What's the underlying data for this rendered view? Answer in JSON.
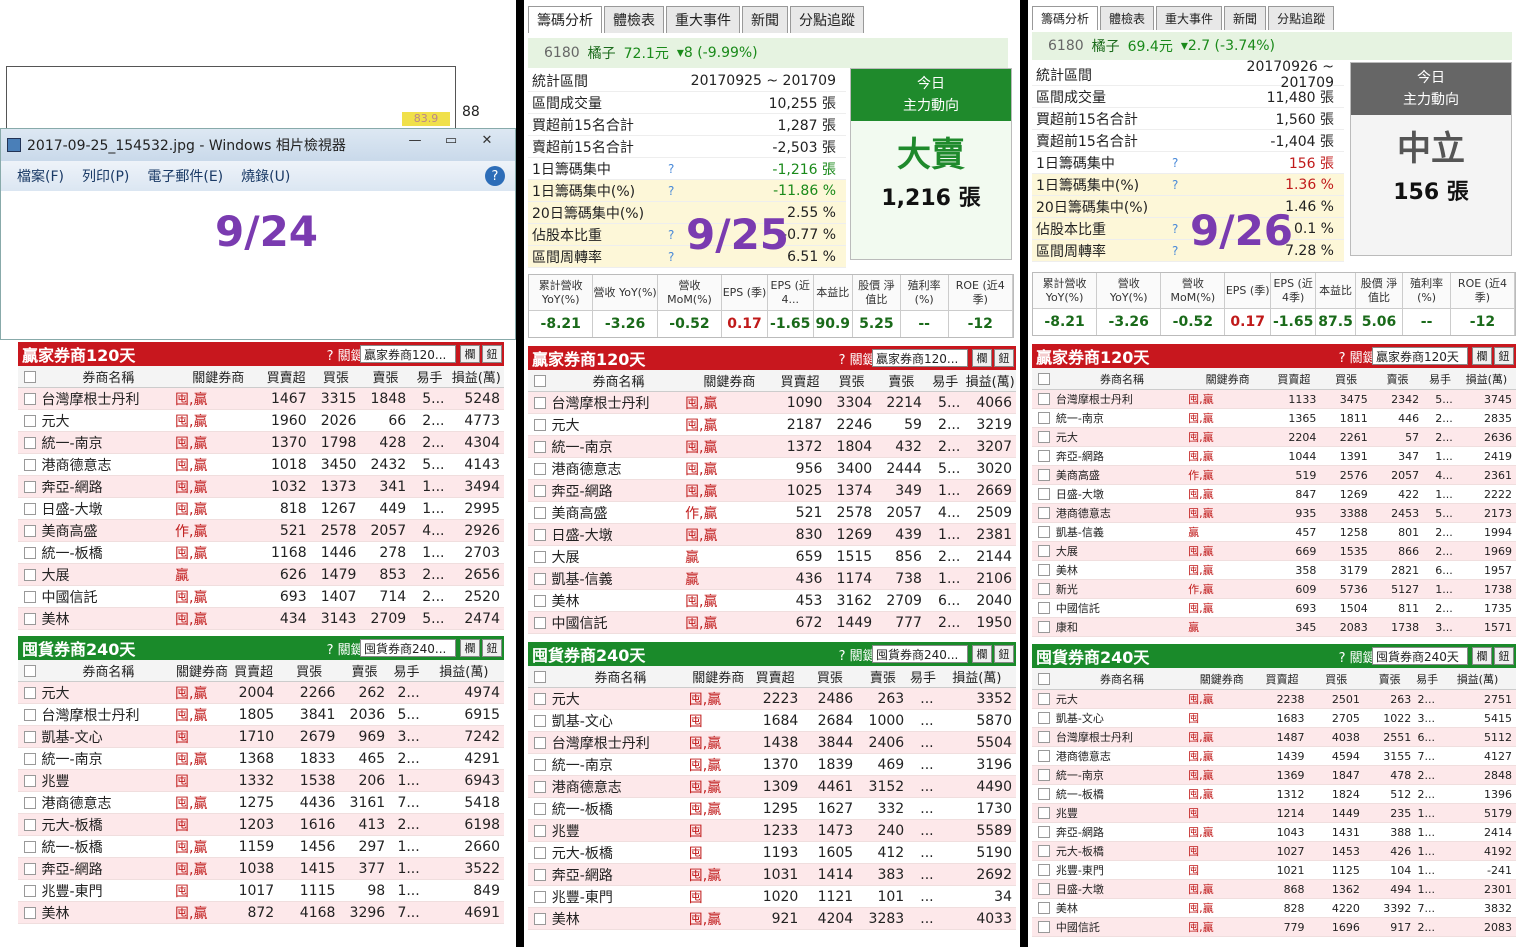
{
  "viewer": {
    "title": "2017-09-25_154532.jpg - Windows 相片檢視器",
    "menu": [
      "檔案(F)",
      "列印(P)",
      "電子郵件(E)",
      "燒錄(U)"
    ],
    "help": "?"
  },
  "dates": [
    "9/24",
    "9/25",
    "9/26"
  ],
  "bg": {
    "v88": "88",
    "v839": "83.9"
  },
  "tabs": [
    "籌碼分析",
    "體檢表",
    "重大事件",
    "新聞",
    "分點追蹤"
  ],
  "panels": [
    {
      "code": "6180",
      "name": "橘子",
      "price": "72.1元",
      "change": "▾8 (-9.99%)",
      "stats": [
        [
          "統計區間",
          "",
          "20170925 ~ 201709"
        ],
        [
          "區間成交量",
          "",
          "10,255 張"
        ],
        [
          "買超前15名合計",
          "",
          "1,287 張"
        ],
        [
          "賣超前15名合計",
          "",
          "-2,503 張"
        ],
        [
          "1日籌碼集中",
          "?",
          "-1,216 張"
        ],
        [
          "1日籌碼集中(%)",
          "?",
          "-11.86 %"
        ],
        [
          "20日籌碼集中(%)",
          "",
          "2.55 %"
        ],
        [
          "佔股本比重",
          "?",
          "-0.77 %"
        ],
        [
          "區間周轉率",
          "?",
          "6.51 %"
        ]
      ],
      "today": "今日",
      "main": "主力動向",
      "verdict": "大賣",
      "amount": "1,216 張",
      "ratio_h": [
        "累計營收 YoY(%)",
        "營收 YoY(%)",
        "營收 MoM(%)",
        "EPS (季)",
        "EPS (近4...",
        "本益比",
        "股價 淨值比",
        "殖利率 (%)",
        "ROE (近4季)"
      ],
      "ratio_v": [
        "-8.21",
        "-3.26",
        "-0.52",
        "0.17",
        "-1.65",
        "90.9",
        "5.25",
        "--",
        "-12"
      ]
    },
    {
      "code": "6180",
      "name": "橘子",
      "price": "69.4元",
      "change": "▾2.7 (-3.74%)",
      "stats": [
        [
          "統計區間",
          "",
          "20170926 ~ 201709"
        ],
        [
          "區間成交量",
          "",
          "11,480 張"
        ],
        [
          "買超前15名合計",
          "",
          "1,560 張"
        ],
        [
          "賣超前15名合計",
          "",
          "-1,404 張"
        ],
        [
          "1日籌碼集中",
          "?",
          "156 張"
        ],
        [
          "1日籌碼集中(%)",
          "?",
          "1.36 %"
        ],
        [
          "20日籌碼集中(%)",
          "",
          "1.46 %"
        ],
        [
          "佔股本比重",
          "?",
          "0.1 %"
        ],
        [
          "區間周轉率",
          "?",
          "7.28 %"
        ]
      ],
      "today": "今日",
      "main": "主力動向",
      "verdict": "中立",
      "amount": "156 張",
      "ratio_h": [
        "累計營收 YoY(%)",
        "營收 YoY(%)",
        "營收 MoM(%)",
        "EPS (季)",
        "EPS (近4季)",
        "本益比",
        "股價 淨值比",
        "殖利率 (%)",
        "ROE (近4季)"
      ],
      "ratio_v": [
        "-8.21",
        "-3.26",
        "-0.52",
        "0.17",
        "-1.65",
        "87.5",
        "5.06",
        "--",
        "-12"
      ]
    }
  ],
  "win_title": "贏家券商120天",
  "gov_title": "囤貨券商240天",
  "kq": "? 關鍵券商:",
  "win_sel": "贏家券商120...",
  "gov_sel": "囤貨券商240...",
  "win_sel3": "贏家券商120天",
  "gov_sel3": "囤貨券商240天",
  "btn1": "欄",
  "btn2": "鈕",
  "win_cols": [
    "券商名稱",
    "關鍵券商",
    "買賣超",
    "買張",
    "賣張",
    "易手",
    "損益(萬)"
  ],
  "gov_cols": [
    "券商名稱",
    "關鍵券商",
    "買賣超",
    "買張",
    "賣張",
    "易手",
    "損益(萬)"
  ],
  "t1w": [
    [
      "台灣摩根士丹利",
      "囤,贏",
      "1467",
      "3315",
      "1848",
      "5...",
      "5248"
    ],
    [
      "元大",
      "囤,贏",
      "1960",
      "2026",
      "66",
      "2...",
      "4773"
    ],
    [
      "統一-南京",
      "囤,贏",
      "1370",
      "1798",
      "428",
      "2...",
      "4304"
    ],
    [
      "港商德意志",
      "囤,贏",
      "1018",
      "3450",
      "2432",
      "5...",
      "4143"
    ],
    [
      "奔亞-網路",
      "囤,贏",
      "1032",
      "1373",
      "341",
      "1...",
      "3494"
    ],
    [
      "日盛-大墩",
      "囤,贏",
      "818",
      "1267",
      "449",
      "1...",
      "2995"
    ],
    [
      "美商高盛",
      "作,贏",
      "521",
      "2578",
      "2057",
      "4...",
      "2926"
    ],
    [
      "統一-板橋",
      "囤,贏",
      "1168",
      "1446",
      "278",
      "1...",
      "2703"
    ],
    [
      "大展",
      "贏",
      "626",
      "1479",
      "853",
      "2...",
      "2656"
    ],
    [
      "中國信託",
      "囤,贏",
      "693",
      "1407",
      "714",
      "2...",
      "2520"
    ],
    [
      "美林",
      "囤,贏",
      "434",
      "3143",
      "2709",
      "5...",
      "2474"
    ]
  ],
  "t1g": [
    [
      "元大",
      "囤,贏",
      "2004",
      "2266",
      "262",
      "2...",
      "4974"
    ],
    [
      "台灣摩根士丹利",
      "囤,贏",
      "1805",
      "3841",
      "2036",
      "5...",
      "6915"
    ],
    [
      "凱基-文心",
      "囤",
      "1710",
      "2679",
      "969",
      "3...",
      "7242"
    ],
    [
      "統一-南京",
      "囤,贏",
      "1368",
      "1833",
      "465",
      "2...",
      "4291"
    ],
    [
      "兆豐",
      "囤",
      "1332",
      "1538",
      "206",
      "1...",
      "6943"
    ],
    [
      "港商德意志",
      "囤,贏",
      "1275",
      "4436",
      "3161",
      "7...",
      "5418"
    ],
    [
      "元大-板橋",
      "囤",
      "1203",
      "1616",
      "413",
      "2...",
      "6198"
    ],
    [
      "統一-板橋",
      "囤,贏",
      "1159",
      "1456",
      "297",
      "1...",
      "2660"
    ],
    [
      "奔亞-網路",
      "囤,贏",
      "1038",
      "1415",
      "377",
      "1...",
      "3522"
    ],
    [
      "兆豐-東門",
      "囤",
      "1017",
      "1115",
      "98",
      "1...",
      "849"
    ],
    [
      "美林",
      "囤,贏",
      "872",
      "4168",
      "3296",
      "7...",
      "4691"
    ]
  ],
  "t2w": [
    [
      "台灣摩根士丹利",
      "囤,贏",
      "1090",
      "3304",
      "2214",
      "5...",
      "4066"
    ],
    [
      "元大",
      "囤,贏",
      "2187",
      "2246",
      "59",
      "2...",
      "3219"
    ],
    [
      "統一-南京",
      "囤,贏",
      "1372",
      "1804",
      "432",
      "2...",
      "3207"
    ],
    [
      "港商德意志",
      "囤,贏",
      "956",
      "3400",
      "2444",
      "5...",
      "3020"
    ],
    [
      "奔亞-網路",
      "囤,贏",
      "1025",
      "1374",
      "349",
      "1...",
      "2669"
    ],
    [
      "美商高盛",
      "作,贏",
      "521",
      "2578",
      "2057",
      "4...",
      "2509"
    ],
    [
      "日盛-大墩",
      "囤,贏",
      "830",
      "1269",
      "439",
      "1...",
      "2381"
    ],
    [
      "大展",
      "贏",
      "659",
      "1515",
      "856",
      "2...",
      "2144"
    ],
    [
      "凱基-信義",
      "贏",
      "436",
      "1174",
      "738",
      "1...",
      "2106"
    ],
    [
      "美林",
      "囤,贏",
      "453",
      "3162",
      "2709",
      "6...",
      "2040"
    ],
    [
      "中國信託",
      "囤,贏",
      "672",
      "1449",
      "777",
      "2...",
      "1950"
    ]
  ],
  "t2g": [
    [
      "元大",
      "囤,贏",
      "2223",
      "2486",
      "263",
      "...",
      "3352"
    ],
    [
      "凱基-文心",
      "囤",
      "1684",
      "2684",
      "1000",
      "...",
      "5870"
    ],
    [
      "台灣摩根士丹利",
      "囤,贏",
      "1438",
      "3844",
      "2406",
      "...",
      "5504"
    ],
    [
      "統一-南京",
      "囤,贏",
      "1370",
      "1839",
      "469",
      "...",
      "3196"
    ],
    [
      "港商德意志",
      "囤,贏",
      "1309",
      "4461",
      "3152",
      "...",
      "4490"
    ],
    [
      "統一-板橋",
      "囤,贏",
      "1295",
      "1627",
      "332",
      "...",
      "1730"
    ],
    [
      "兆豐",
      "囤",
      "1233",
      "1473",
      "240",
      "...",
      "5589"
    ],
    [
      "元大-板橋",
      "囤",
      "1193",
      "1605",
      "412",
      "...",
      "5190"
    ],
    [
      "奔亞-網路",
      "囤,贏",
      "1031",
      "1414",
      "383",
      "...",
      "2692"
    ],
    [
      "兆豐-東門",
      "囤",
      "1020",
      "1121",
      "101",
      "...",
      "34"
    ],
    [
      "美林",
      "囤,贏",
      "921",
      "4204",
      "3283",
      "...",
      "4033"
    ]
  ],
  "t3w": [
    [
      "台灣摩根士丹利",
      "囤,贏",
      "1133",
      "3475",
      "2342",
      "5...",
      "3745"
    ],
    [
      "統一-南京",
      "囤,贏",
      "1365",
      "1811",
      "446",
      "2...",
      "2835"
    ],
    [
      "元大",
      "囤,贏",
      "2204",
      "2261",
      "57",
      "2...",
      "2636"
    ],
    [
      "奔亞-網路",
      "囤,贏",
      "1044",
      "1391",
      "347",
      "1...",
      "2419"
    ],
    [
      "美商高盛",
      "作,贏",
      "519",
      "2576",
      "2057",
      "4...",
      "2361"
    ],
    [
      "日盛-大墩",
      "囤,贏",
      "847",
      "1269",
      "422",
      "1...",
      "2222"
    ],
    [
      "港商德意志",
      "囤,贏",
      "935",
      "3388",
      "2453",
      "5...",
      "2173"
    ],
    [
      "凱基-信義",
      "贏",
      "457",
      "1258",
      "801",
      "2...",
      "1994"
    ],
    [
      "大展",
      "囤,贏",
      "669",
      "1535",
      "866",
      "2...",
      "1969"
    ],
    [
      "美林",
      "囤,贏",
      "358",
      "3179",
      "2821",
      "6...",
      "1957"
    ],
    [
      "新光",
      "作,贏",
      "609",
      "5736",
      "5127",
      "1...",
      "1738"
    ],
    [
      "中國信託",
      "囤,贏",
      "693",
      "1504",
      "811",
      "2...",
      "1735"
    ],
    [
      "康和",
      "贏",
      "345",
      "2083",
      "1738",
      "3...",
      "1571"
    ]
  ],
  "t3g": [
    [
      "元大",
      "囤,贏",
      "2238",
      "2501",
      "263",
      "2...",
      "2751"
    ],
    [
      "凱基-文心",
      "囤",
      "1683",
      "2705",
      "1022",
      "3...",
      "5415"
    ],
    [
      "台灣摩根士丹利",
      "囤,贏",
      "1487",
      "4038",
      "2551",
      "6...",
      "5112"
    ],
    [
      "港商德意志",
      "囤,贏",
      "1439",
      "4594",
      "3155",
      "7...",
      "4127"
    ],
    [
      "統一-南京",
      "囤,贏",
      "1369",
      "1847",
      "478",
      "2...",
      "2848"
    ],
    [
      "統一-板橋",
      "囤,贏",
      "1312",
      "1824",
      "512",
      "2...",
      "1396"
    ],
    [
      "兆豐",
      "囤",
      "1214",
      "1449",
      "235",
      "1...",
      "5179"
    ],
    [
      "奔亞-網路",
      "囤,贏",
      "1043",
      "1431",
      "388",
      "1...",
      "2414"
    ],
    [
      "元大-板橋",
      "囤",
      "1027",
      "1453",
      "426",
      "1...",
      "4192"
    ],
    [
      "兆豐-東門",
      "囤",
      "1021",
      "1125",
      "104",
      "1...",
      "-241"
    ],
    [
      "日盛-大墩",
      "囤,贏",
      "868",
      "1362",
      "494",
      "1...",
      "2301"
    ],
    [
      "美林",
      "囤,贏",
      "828",
      "4220",
      "3392",
      "7...",
      "3832"
    ],
    [
      "中國信託",
      "囤,贏",
      "779",
      "1696",
      "917",
      "2...",
      "2083"
    ]
  ]
}
